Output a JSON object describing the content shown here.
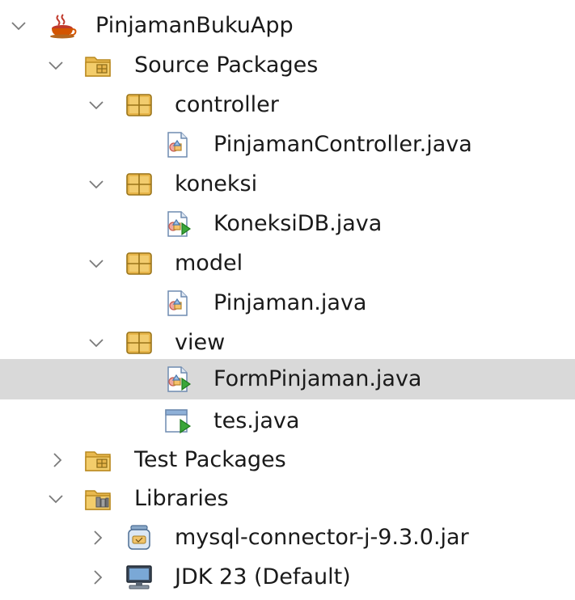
{
  "colors": {
    "selection": "#d9d9d9",
    "folder": "#e8b84e",
    "folder_dark": "#b98a20",
    "package": "#e7b54a",
    "java_file_accent": "#3aa63a"
  },
  "tree": {
    "project": {
      "label": "PinjamanBukuApp",
      "icon": "coffee-cup-icon",
      "expanded": true
    },
    "source_packages": {
      "label": "Source Packages",
      "icon": "source-folder-icon",
      "expanded": true
    },
    "packages": [
      {
        "label": "controller",
        "icon": "package-icon",
        "expanded": true,
        "files": [
          {
            "label": "PinjamanController.java",
            "icon": "java-class-icon"
          }
        ]
      },
      {
        "label": "koneksi",
        "icon": "package-icon",
        "expanded": true,
        "files": [
          {
            "label": "KoneksiDB.java",
            "icon": "java-main-class-icon"
          }
        ]
      },
      {
        "label": "model",
        "icon": "package-icon",
        "expanded": true,
        "files": [
          {
            "label": "Pinjaman.java",
            "icon": "java-class-icon"
          }
        ]
      },
      {
        "label": "view",
        "icon": "package-icon",
        "expanded": true,
        "files": [
          {
            "label": "FormPinjaman.java",
            "icon": "java-main-class-icon",
            "selected": true
          },
          {
            "label": "tes.java",
            "icon": "java-runnable-form-icon"
          }
        ]
      }
    ],
    "test_packages": {
      "label": "Test Packages",
      "icon": "test-folder-icon",
      "expanded": false
    },
    "libraries": {
      "label": "Libraries",
      "icon": "libraries-folder-icon",
      "expanded": true,
      "items": [
        {
          "label": "mysql-connector-j-9.3.0.jar",
          "icon": "jar-icon",
          "expanded": false
        },
        {
          "label": "JDK 23 (Default)",
          "icon": "jdk-computer-icon",
          "expanded": false
        }
      ]
    }
  }
}
